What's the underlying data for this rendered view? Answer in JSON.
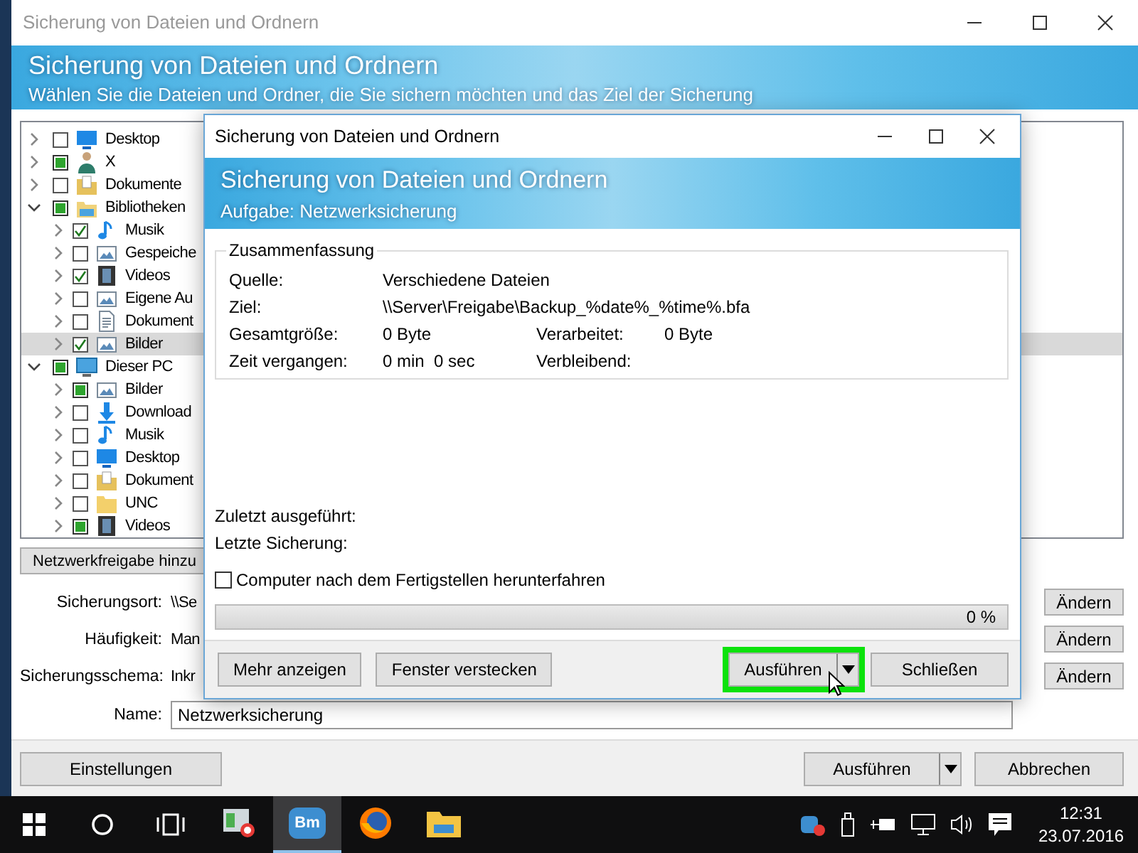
{
  "main_window": {
    "title": "Sicherung von Dateien und Ordnern",
    "header_title": "Sicherung von Dateien und Ordnern",
    "header_subtitle": "Wählen Sie die Dateien und Ordner, die Sie sichern möchten und das Ziel der Sicherung",
    "tree": [
      {
        "label": "Desktop",
        "kind": "desktop",
        "checked": false,
        "partial": false,
        "expanded": false,
        "selected": false
      },
      {
        "label": "X",
        "kind": "user",
        "checked": false,
        "partial": true,
        "expanded": false,
        "selected": false
      },
      {
        "label": "Dokumente",
        "kind": "documents",
        "checked": false,
        "partial": false,
        "expanded": false,
        "selected": false
      },
      {
        "label": "Bibliotheken",
        "kind": "library",
        "checked": false,
        "partial": true,
        "expanded": true,
        "selected": false,
        "children": [
          {
            "label": "Musik",
            "kind": "music",
            "checked": true,
            "partial": false,
            "expanded": false,
            "selected": false
          },
          {
            "label": "Gespeiche",
            "kind": "pictures",
            "checked": false,
            "partial": false,
            "expanded": false,
            "selected": false
          },
          {
            "label": "Videos",
            "kind": "video",
            "checked": true,
            "partial": false,
            "expanded": false,
            "selected": false
          },
          {
            "label": "Eigene Au",
            "kind": "pictures",
            "checked": false,
            "partial": false,
            "expanded": false,
            "selected": false
          },
          {
            "label": "Dokument",
            "kind": "document",
            "checked": false,
            "partial": false,
            "expanded": false,
            "selected": false
          },
          {
            "label": "Bilder",
            "kind": "pictures",
            "checked": true,
            "partial": false,
            "expanded": false,
            "selected": true
          }
        ]
      },
      {
        "label": "Dieser PC",
        "kind": "pc",
        "checked": false,
        "partial": true,
        "expanded": true,
        "selected": false,
        "children": [
          {
            "label": "Bilder",
            "kind": "pictures",
            "checked": false,
            "partial": true,
            "expanded": false,
            "selected": false
          },
          {
            "label": "Download",
            "kind": "download",
            "checked": false,
            "partial": false,
            "expanded": false,
            "selected": false
          },
          {
            "label": "Musik",
            "kind": "music",
            "checked": false,
            "partial": false,
            "expanded": false,
            "selected": false
          },
          {
            "label": "Desktop",
            "kind": "desktop",
            "checked": false,
            "partial": false,
            "expanded": false,
            "selected": false
          },
          {
            "label": "Dokument",
            "kind": "documents",
            "checked": false,
            "partial": false,
            "expanded": false,
            "selected": false
          },
          {
            "label": "UNC",
            "kind": "folder",
            "checked": false,
            "partial": false,
            "expanded": false,
            "selected": false
          },
          {
            "label": "Videos",
            "kind": "video",
            "checked": false,
            "partial": true,
            "expanded": false,
            "selected": false
          }
        ]
      }
    ],
    "add_share_button": "Netzwerkfreigabe hinzu",
    "settings": [
      {
        "label": "Sicherungsort:",
        "value": "\\\\Se",
        "button": "Ändern"
      },
      {
        "label": "Häufigkeit:",
        "value": "Man",
        "button": "Ändern"
      },
      {
        "label": "Sicherungsschema:",
        "value": "Inkr",
        "button": "Ändern"
      }
    ],
    "name": {
      "label": "Name:",
      "value": "Netzwerksicherung"
    },
    "buttons": {
      "settings": "Einstellungen",
      "run": "Ausführen",
      "cancel": "Abbrechen"
    }
  },
  "dialog": {
    "title": "Sicherung von Dateien und Ordnern",
    "header_title": "Sicherung von Dateien und Ordnern",
    "header_subtitle": "Aufgabe: Netzwerksicherung",
    "summary": {
      "title": "Zusammenfassung",
      "rows": [
        {
          "label": "Quelle:",
          "value": "Verschiedene Dateien"
        },
        {
          "label": "Ziel:",
          "value": "\\\\Server\\Freigabe\\Backup_%date%_%time%.bfa"
        },
        {
          "label": "Gesamtgröße:",
          "value": "0 Byte",
          "label_2": "Verarbeitet:",
          "value_2": "0 Byte"
        },
        {
          "label": "Zeit vergangen:",
          "value": "0 min  0 sec",
          "label_2": "Verbleibend:"
        }
      ]
    },
    "last_run_label": "Zuletzt ausgeführt:",
    "last_backup_label": "Letzte Sicherung:",
    "shutdown": {
      "label": "Computer nach dem Fertigstellen herunterfahren",
      "checked": false
    },
    "progress": {
      "level": 0,
      "reading": "0 %"
    },
    "buttons": [
      {
        "label": "Mehr anzeigen",
        "kind": "plain",
        "highlighted": false
      },
      {
        "label": "Fenster verstecken",
        "kind": "plain",
        "highlighted": false
      },
      {
        "label": "Ausführen",
        "kind": "split",
        "highlighted": true
      },
      {
        "label": "Schließen",
        "kind": "plain",
        "highlighted": false
      }
    ]
  },
  "taskbar": {
    "apps": [
      {
        "kind": "media",
        "active": false
      },
      {
        "kind": "bm",
        "label": "Bm",
        "active": true
      },
      {
        "kind": "browser",
        "active": false
      },
      {
        "kind": "explorer",
        "active": false
      }
    ],
    "time": "12:31",
    "date": "23.07.2016"
  }
}
